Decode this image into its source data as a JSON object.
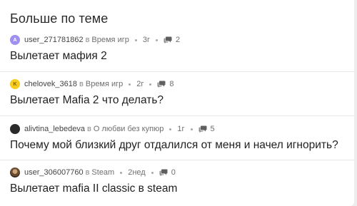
{
  "section": {
    "title": "Больше по теме"
  },
  "posts": [
    {
      "avatar_letter": "A",
      "username": "user_271781862",
      "in_word": "в",
      "topic": "Время игр",
      "age": "3г",
      "comments": "2",
      "title": "Вылетает мафия 2"
    },
    {
      "avatar_letter": "K",
      "username": "chelovek_3618",
      "in_word": "в",
      "topic": "Время игр",
      "age": "2г",
      "comments": "8",
      "title": "Вылетает Mafia 2 что делать?"
    },
    {
      "avatar_letter": "",
      "username": "alivtina_lebedeva",
      "in_word": "в",
      "topic": "О любви без купюр",
      "age": "1г",
      "comments": "5",
      "title": "Почему мой близкий друг отдалился от меня и начел игнорить?"
    },
    {
      "avatar_letter": "",
      "username": "user_306007760",
      "in_word": "в",
      "topic": "Steam",
      "age": "2нед",
      "comments": "0",
      "title": "Вылетает mafia II classic в steam"
    }
  ],
  "icons": {
    "comments": "comments-icon",
    "separator": "dot-separator"
  }
}
